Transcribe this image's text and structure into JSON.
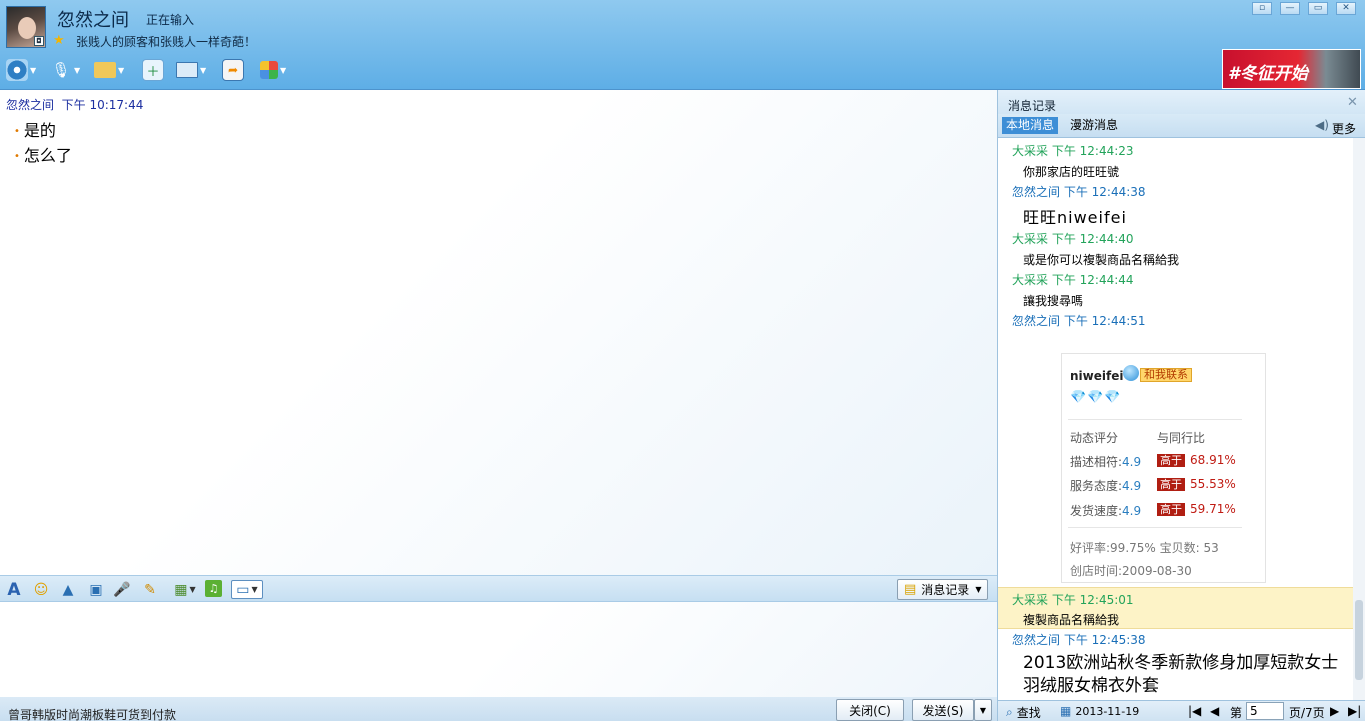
{
  "header": {
    "contact_name": "忽然之间",
    "typing_status": "正在输入",
    "signature": "张贱人的顾客和张贱人一样奇葩！",
    "banner_text": "#冬征开始",
    "window_buttons": [
      "▫",
      "—",
      "▭",
      "✕"
    ]
  },
  "chat": {
    "sender": "忽然之间",
    "time": "下午 10:17:44",
    "lines": [
      "是的",
      "怎么了"
    ]
  },
  "input_toolbar": {
    "history_label": "消息记录"
  },
  "status_bar": {
    "ad_text": "曾哥韩版时尚潮板鞋可货到付款",
    "close_label": "关闭(C)",
    "send_label": "发送(S)"
  },
  "history_panel": {
    "title": "消息记录",
    "tabs": [
      "本地消息",
      "漫游消息"
    ],
    "more_label": "更多",
    "messages": [
      {
        "header": "大采采 下午 12:44:23",
        "text": "你那家店的旺旺號"
      },
      {
        "header": "忽然之间 下午 12:44:38",
        "text": "旺旺niweifei"
      },
      {
        "header": "大采采 下午 12:44:40",
        "text": "或是你可以複製商品名稱給我"
      },
      {
        "header": "大采采 下午 12:44:44",
        "text": "讓我搜尋嗎"
      },
      {
        "header": "忽然之间 下午 12:44:51",
        "text": ""
      },
      {
        "header": "大采采 下午 12:45:01",
        "text": "複製商品名稱給我"
      },
      {
        "header": "忽然之间 下午 12:45:38",
        "text": "2013欧洲站秋冬季新款修身加厚短款女士羽绒服女棉衣外套"
      }
    ],
    "shop_card": {
      "name": "niweifei",
      "contact_tag": "和我联系",
      "diamonds": "💎💎💎",
      "col1": "动态评分",
      "col2": "与同行比",
      "rows": [
        {
          "label": "描述相符:",
          "score": "4.9",
          "badge": "高于",
          "pct": "68.91%"
        },
        {
          "label": "服务态度:",
          "score": "4.9",
          "badge": "高于",
          "pct": "55.53%"
        },
        {
          "label": "发货速度:",
          "score": "4.9",
          "badge": "高于",
          "pct": "59.71%"
        }
      ],
      "rating_line": "好评率:99.75% 宝贝数: 53",
      "open_date": "创店时间:2009-08-30"
    },
    "bottom": {
      "search_label": "查找",
      "date": "2013-11-19",
      "page_prefix": "第",
      "page_value": "5",
      "page_suffix": "页/7页"
    }
  }
}
